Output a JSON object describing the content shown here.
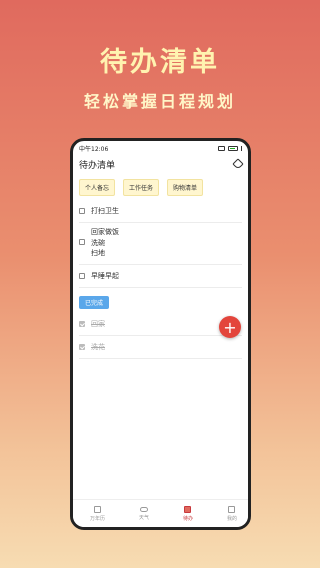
{
  "promo": {
    "title": "待办清单",
    "subtitle": "轻松掌握日程规划"
  },
  "status": {
    "time": "中午12:06"
  },
  "app": {
    "title": "待办清单"
  },
  "tabs": [
    "个人备忘",
    "工作任务",
    "购物清单"
  ],
  "todo": [
    {
      "lines": [
        "打扫卫生"
      ],
      "done": false
    },
    {
      "lines": [
        "回家做饭",
        "洗碗",
        "扫地"
      ],
      "done": false
    },
    {
      "lines": [
        "早睡早起"
      ],
      "done": false
    }
  ],
  "completed_label": "已完成",
  "completed": [
    {
      "text": "回家",
      "done": true
    },
    {
      "text": "洗花",
      "done": true
    }
  ],
  "fab": "+",
  "nav": [
    {
      "label": "万年历",
      "icon": "calendar-icon"
    },
    {
      "label": "天气",
      "icon": "cloud-icon"
    },
    {
      "label": "待办",
      "icon": "todo-icon",
      "active": true
    },
    {
      "label": "我的",
      "icon": "profile-icon"
    }
  ],
  "colors": {
    "accent": "#e3453c",
    "badge": "#5aa7ea",
    "tab_bg": "#fff6cf"
  }
}
